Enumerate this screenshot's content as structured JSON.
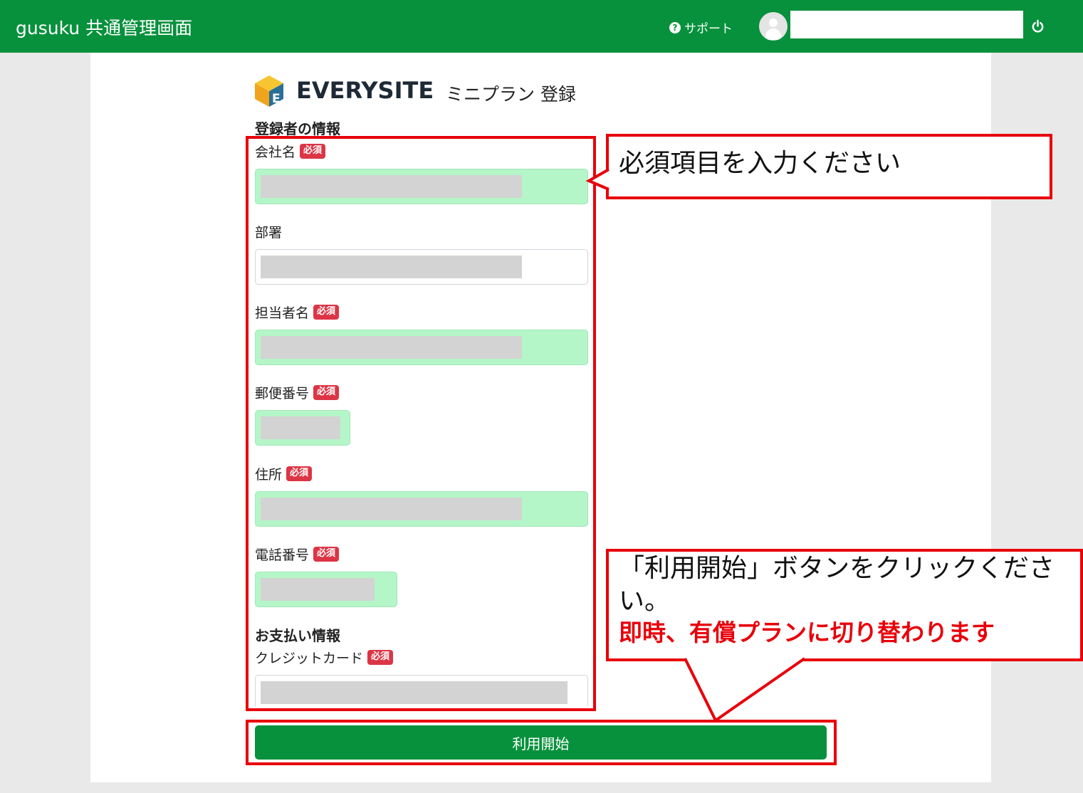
{
  "header": {
    "app_title": "gusuku 共通管理画面",
    "support_label": "サポート",
    "username_value": ""
  },
  "brand": {
    "name": "EVERYSITE",
    "page_title": "ミニプラン 登録"
  },
  "form": {
    "registrant_section": "登録者の情報",
    "required_badge": "必須",
    "fields": [
      {
        "label": "会社名",
        "required": true,
        "value": ""
      },
      {
        "label": "部署",
        "required": false,
        "value": ""
      },
      {
        "label": "担当者名",
        "required": true,
        "value": ""
      },
      {
        "label": "郵便番号",
        "required": true,
        "value": ""
      },
      {
        "label": "住所",
        "required": true,
        "value": ""
      },
      {
        "label": "電話番号",
        "required": true,
        "value": ""
      }
    ],
    "payment_section": "お支払い情報",
    "payment_field": {
      "label": "クレジットカード",
      "required": true,
      "value": ""
    },
    "submit_label": "利用開始"
  },
  "annotations": {
    "required_callout": "必須項目を入力ください",
    "click_callout": "「利用開始」ボタンをクリックください。",
    "click_callout_emphasis": "即時、有償プランに切り替わります"
  },
  "colors": {
    "header": "#07913c",
    "required_input_bg": "#b4f6c8",
    "required_badge": "#dc3545",
    "annotation_red": "#e8000a",
    "button": "#07913c"
  }
}
